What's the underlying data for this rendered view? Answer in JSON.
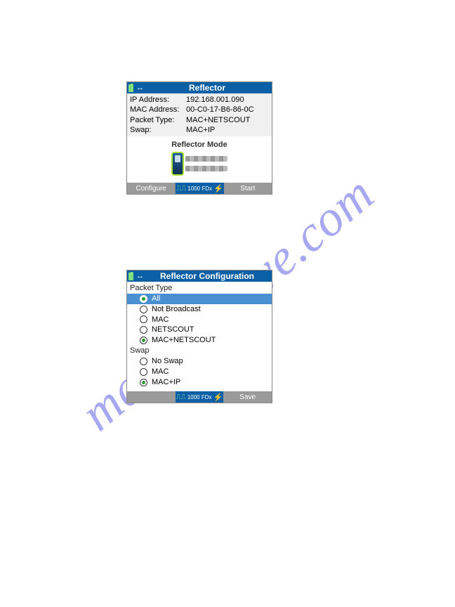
{
  "watermark_text": "manualshive.com",
  "screen1": {
    "title": "Reflector",
    "info": {
      "ip_label": "IP Address:",
      "ip_value": "192.168.001.090",
      "mac_label": "MAC Address:",
      "mac_value": "00-C0-17-B6-86-0C",
      "packet_label": "Packet Type:",
      "packet_value": "MAC+NETSCOUT",
      "swap_label": "Swap:",
      "swap_value": "MAC+IP"
    },
    "mode_label": "Reflector Mode",
    "link_status": "1000 FDx",
    "btn_left": "Configure",
    "btn_right": "Start"
  },
  "screen2": {
    "title": "Reflector Configuration",
    "group1_label": "Packet Type",
    "packet_options": [
      {
        "label": "All",
        "checked": true,
        "highlighted": true
      },
      {
        "label": "Not Broadcast",
        "checked": false,
        "highlighted": false
      },
      {
        "label": "MAC",
        "checked": false,
        "highlighted": false
      },
      {
        "label": "NETSCOUT",
        "checked": false,
        "highlighted": false
      },
      {
        "label": "MAC+NETSCOUT",
        "checked": true,
        "highlighted": false
      }
    ],
    "group2_label": "Swap",
    "swap_options": [
      {
        "label": "No Swap",
        "checked": false
      },
      {
        "label": "MAC",
        "checked": false
      },
      {
        "label": "MAC+IP",
        "checked": true
      }
    ],
    "link_status": "1000 FDx",
    "btn_right": "Save"
  }
}
